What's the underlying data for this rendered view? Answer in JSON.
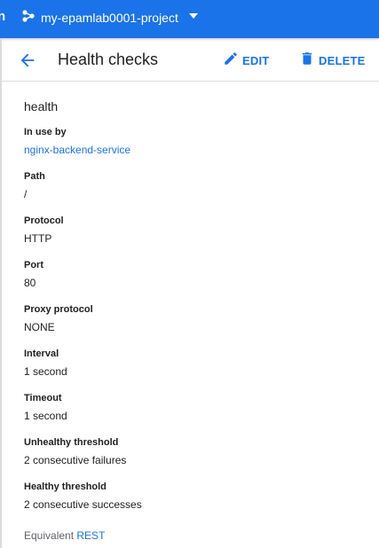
{
  "topbar": {
    "edge_glyph": "n",
    "project_name": "my-epamlab0001-project",
    "project_icon": "project-hierarchy-icon",
    "caret_icon": "chevron-down-icon",
    "color": "#1a73e8"
  },
  "header": {
    "back_icon": "arrow-back-icon",
    "title": "Health checks",
    "edit_label": "EDIT",
    "delete_label": "DELETE",
    "accent": "#1a73e8"
  },
  "health_check": {
    "name": "health",
    "fields": [
      {
        "label": "In use by",
        "value": "nginx-backend-service",
        "link": true
      },
      {
        "label": "Path",
        "value": "/"
      },
      {
        "label": "Protocol",
        "value": "HTTP"
      },
      {
        "label": "Port",
        "value": "80"
      },
      {
        "label": "Proxy protocol",
        "value": "NONE"
      },
      {
        "label": "Interval",
        "value": "1 second"
      },
      {
        "label": "Timeout",
        "value": "1 second"
      },
      {
        "label": "Unhealthy threshold",
        "value": "2 consecutive failures"
      },
      {
        "label": "Healthy threshold",
        "value": "2 consecutive successes"
      }
    ]
  },
  "footer": {
    "equivalent_label": "Equivalent",
    "rest_link": "REST"
  }
}
